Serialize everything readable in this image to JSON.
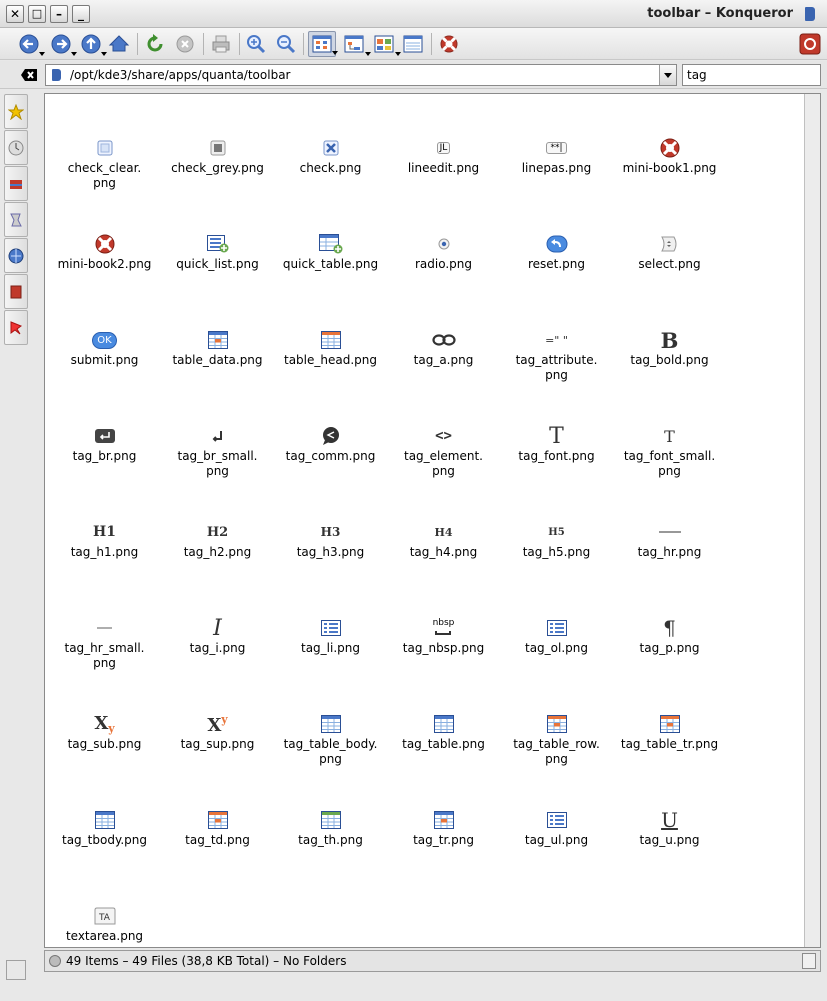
{
  "window": {
    "title": "toolbar – Konqueror",
    "buttons": [
      "close",
      "maximize",
      "minimize",
      "shade"
    ]
  },
  "toolbar": {
    "buttons": [
      "back-icon",
      "forward-icon",
      "up-icon",
      "home-icon",
      "reload-icon",
      "stop-icon",
      "print-icon",
      "zoom-in-icon",
      "zoom-out-icon",
      "icon-view-icon",
      "tree-view-icon",
      "multi-column-icon",
      "detailed-view-icon",
      "help-lifebuoy-icon",
      "konqueror-close-icon"
    ]
  },
  "location": {
    "url": "/opt/kde3/share/apps/quanta/toolbar",
    "search_value": "tag"
  },
  "sidebar": {
    "tabs": [
      "bookmarks-icon",
      "history-icon",
      "home-folder-icon",
      "services-icon",
      "network-icon",
      "media-icon",
      "favorites-pin-icon"
    ]
  },
  "files": [
    {
      "name": "check_clear.\npng",
      "icon": "checkbox-clear-icon"
    },
    {
      "name": "check_grey.png",
      "icon": "checkbox-grey-icon"
    },
    {
      "name": "check.png",
      "icon": "checkbox-checked-icon"
    },
    {
      "name": "lineedit.png",
      "icon": "lineedit-icon"
    },
    {
      "name": "linepas.png",
      "icon": "password-line-icon"
    },
    {
      "name": "mini-book1.png",
      "icon": "lifebuoy-icon"
    },
    {
      "name": "mini-book2.png",
      "icon": "lifebuoy-icon"
    },
    {
      "name": "quick_list.png",
      "icon": "quick-list-icon"
    },
    {
      "name": "quick_table.png",
      "icon": "quick-table-icon"
    },
    {
      "name": "radio.png",
      "icon": "radio-icon"
    },
    {
      "name": "reset.png",
      "icon": "reset-icon"
    },
    {
      "name": "select.png",
      "icon": "select-icon"
    },
    {
      "name": "submit.png",
      "icon": "submit-ok-icon"
    },
    {
      "name": "table_data.png",
      "icon": "table-data-icon"
    },
    {
      "name": "table_head.png",
      "icon": "table-head-icon"
    },
    {
      "name": "tag_a.png",
      "icon": "link-chain-icon"
    },
    {
      "name": "tag_attribute.\npng",
      "icon": "attribute-icon"
    },
    {
      "name": "tag_bold.png",
      "icon": "bold-icon"
    },
    {
      "name": "tag_br.png",
      "icon": "line-break-icon"
    },
    {
      "name": "tag_br_small.\npng",
      "icon": "line-break-small-icon"
    },
    {
      "name": "tag_comm.png",
      "icon": "comment-icon"
    },
    {
      "name": "tag_element.\npng",
      "icon": "element-brackets-icon"
    },
    {
      "name": "tag_font.png",
      "icon": "font-icon"
    },
    {
      "name": "tag_font_small.\npng",
      "icon": "font-small-icon"
    },
    {
      "name": "tag_h1.png",
      "icon": "h1-icon"
    },
    {
      "name": "tag_h2.png",
      "icon": "h2-icon"
    },
    {
      "name": "tag_h3.png",
      "icon": "h3-icon"
    },
    {
      "name": "tag_h4.png",
      "icon": "h4-icon"
    },
    {
      "name": "tag_h5.png",
      "icon": "h5-icon"
    },
    {
      "name": "tag_hr.png",
      "icon": "horizontal-rule-icon"
    },
    {
      "name": "tag_hr_small.\npng",
      "icon": "horizontal-rule-small-icon"
    },
    {
      "name": "tag_i.png",
      "icon": "italic-icon"
    },
    {
      "name": "tag_li.png",
      "icon": "list-item-icon"
    },
    {
      "name": "tag_nbsp.png",
      "icon": "nbsp-icon"
    },
    {
      "name": "tag_ol.png",
      "icon": "ordered-list-icon"
    },
    {
      "name": "tag_p.png",
      "icon": "paragraph-icon"
    },
    {
      "name": "tag_sub.png",
      "icon": "subscript-icon"
    },
    {
      "name": "tag_sup.png",
      "icon": "superscript-icon"
    },
    {
      "name": "tag_table_body.\npng",
      "icon": "table-body-icon"
    },
    {
      "name": "tag_table.png",
      "icon": "table-icon"
    },
    {
      "name": "tag_table_row.\npng",
      "icon": "table-row-icon"
    },
    {
      "name": "tag_table_tr.png",
      "icon": "table-tr-icon"
    },
    {
      "name": "tag_tbody.png",
      "icon": "tbody-icon"
    },
    {
      "name": "tag_td.png",
      "icon": "td-icon"
    },
    {
      "name": "tag_th.png",
      "icon": "th-icon"
    },
    {
      "name": "tag_tr.png",
      "icon": "tr-icon"
    },
    {
      "name": "tag_ul.png",
      "icon": "unordered-list-icon"
    },
    {
      "name": "tag_u.png",
      "icon": "underline-icon"
    },
    {
      "name": "textarea.png",
      "icon": "textarea-icon"
    }
  ],
  "icon_text": {
    "lineedit": "JL",
    "linepas": "**|",
    "submit": "OK",
    "attribute": "=\" \"",
    "bold": "B",
    "element": "<>",
    "font": "T",
    "h1": "H1",
    "h2": "H2",
    "h3": "H3",
    "h4": "H4",
    "h5": "H5",
    "italic": "I",
    "nbsp": "nbsp",
    "paragraph": "¶",
    "sub_base": "X",
    "sub_mark": "y",
    "sup_base": "X",
    "sup_mark": "y",
    "underline": "U",
    "textarea": "TA"
  },
  "status": {
    "text": "49 Items – 49 Files (38,8 KB Total) – No Folders"
  },
  "colors": {
    "accent_blue": "#3a64b0",
    "table_orange": "#e8743a",
    "lifebuoy_red": "#c0392b",
    "table_green": "#6aa84f"
  }
}
